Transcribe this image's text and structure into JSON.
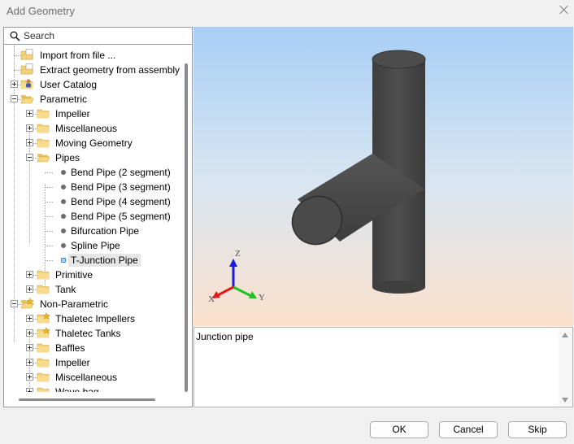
{
  "window": {
    "title": "Add Geometry"
  },
  "search": {
    "placeholder": "Search"
  },
  "tree": [
    {
      "label": "Import from file ...",
      "level": 0,
      "kind": "folder-file"
    },
    {
      "label": "Extract geometry from assembly",
      "level": 0,
      "kind": "folder-file"
    },
    {
      "label": "User Catalog",
      "level": 0,
      "kind": "folder-user",
      "expander": "plus"
    },
    {
      "label": "Parametric",
      "level": 0,
      "kind": "folder-open",
      "expander": "minus"
    },
    {
      "label": "Impeller",
      "level": 1,
      "kind": "folder",
      "expander": "plus"
    },
    {
      "label": "Miscellaneous",
      "level": 1,
      "kind": "folder",
      "expander": "plus"
    },
    {
      "label": "Moving Geometry",
      "level": 1,
      "kind": "folder",
      "expander": "plus"
    },
    {
      "label": "Pipes",
      "level": 1,
      "kind": "folder-open",
      "expander": "minus"
    },
    {
      "label": "Bend Pipe (2 segment)",
      "level": 2,
      "kind": "item"
    },
    {
      "label": "Bend Pipe (3 segment)",
      "level": 2,
      "kind": "item"
    },
    {
      "label": "Bend Pipe (4 segment)",
      "level": 2,
      "kind": "item"
    },
    {
      "label": "Bend Pipe (5 segment)",
      "level": 2,
      "kind": "item"
    },
    {
      "label": "Bifurcation Pipe",
      "level": 2,
      "kind": "item"
    },
    {
      "label": "Spline Pipe",
      "level": 2,
      "kind": "item"
    },
    {
      "label": "T-Junction Pipe",
      "level": 2,
      "kind": "item",
      "selected": true
    },
    {
      "label": "Primitive",
      "level": 1,
      "kind": "folder",
      "expander": "plus"
    },
    {
      "label": "Tank",
      "level": 1,
      "kind": "folder",
      "expander": "plus"
    },
    {
      "label": "Non-Parametric",
      "level": 0,
      "kind": "folder-open-star",
      "expander": "minus"
    },
    {
      "label": "Thaletec Impellers",
      "level": 1,
      "kind": "folder-star",
      "expander": "plus"
    },
    {
      "label": "Thaletec Tanks",
      "level": 1,
      "kind": "folder-star",
      "expander": "plus"
    },
    {
      "label": "Baffles",
      "level": 1,
      "kind": "folder",
      "expander": "plus"
    },
    {
      "label": "Impeller",
      "level": 1,
      "kind": "folder",
      "expander": "plus"
    },
    {
      "label": "Miscellaneous",
      "level": 1,
      "kind": "folder",
      "expander": "plus"
    },
    {
      "label": "Wave bag",
      "level": 1,
      "kind": "folder",
      "expander": "plus"
    }
  ],
  "preview": {
    "axes": {
      "x": "X",
      "y": "Y",
      "z": "Z"
    },
    "colors": {
      "pipe": "#4a4a4a",
      "x_axis": "#e01818",
      "y_axis": "#1ec21e",
      "z_axis": "#1a1ae0"
    }
  },
  "description": {
    "text": "Junction pipe"
  },
  "buttons": {
    "ok": "OK",
    "cancel": "Cancel",
    "skip": "Skip"
  }
}
